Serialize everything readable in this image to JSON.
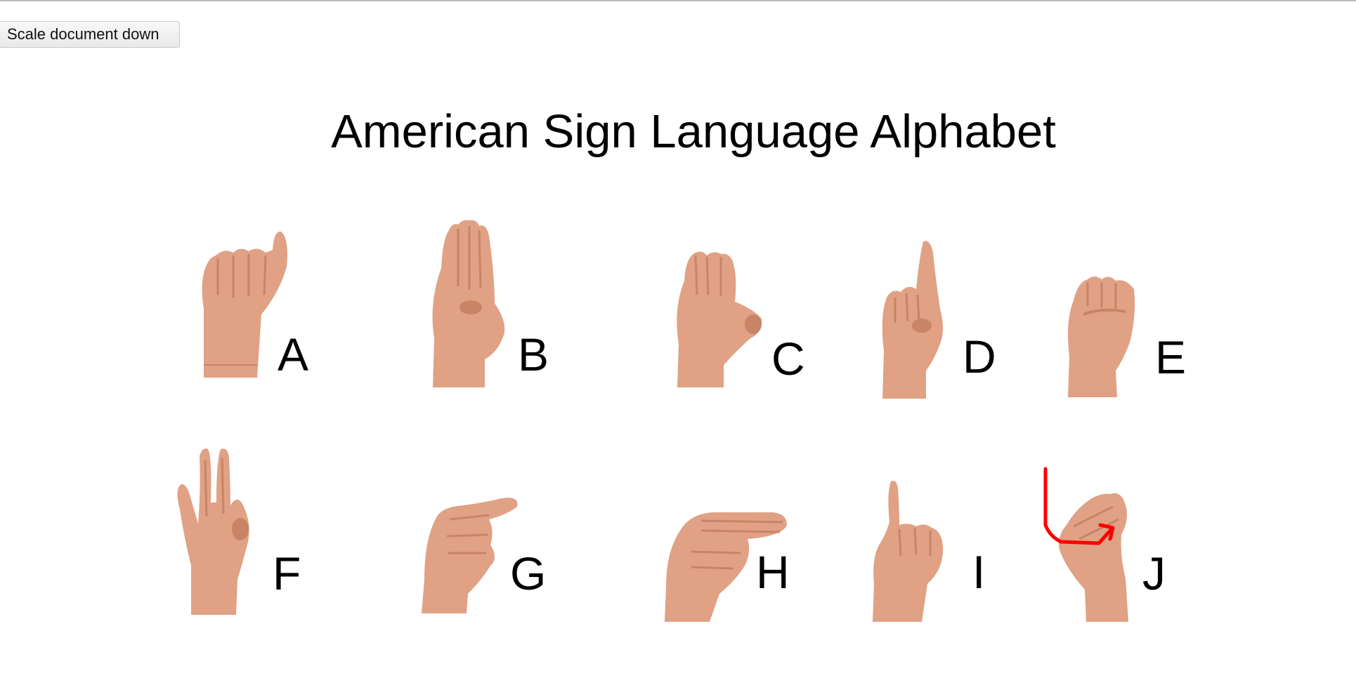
{
  "toolbar": {
    "scale_button_label": "Scale document down"
  },
  "document": {
    "title": "American Sign Language Alphabet",
    "signs": [
      {
        "letter": "A",
        "icon": "hand-sign-a-icon"
      },
      {
        "letter": "B",
        "icon": "hand-sign-b-icon"
      },
      {
        "letter": "C",
        "icon": "hand-sign-c-icon"
      },
      {
        "letter": "D",
        "icon": "hand-sign-d-icon"
      },
      {
        "letter": "E",
        "icon": "hand-sign-e-icon"
      },
      {
        "letter": "F",
        "icon": "hand-sign-f-icon"
      },
      {
        "letter": "G",
        "icon": "hand-sign-g-icon"
      },
      {
        "letter": "H",
        "icon": "hand-sign-h-icon"
      },
      {
        "letter": "I",
        "icon": "hand-sign-i-icon"
      },
      {
        "letter": "J",
        "icon": "hand-sign-j-icon"
      }
    ]
  },
  "colors": {
    "skin": "#e0a184",
    "skin_shadow": "#c98467",
    "motion_arrow": "#ff0000"
  }
}
